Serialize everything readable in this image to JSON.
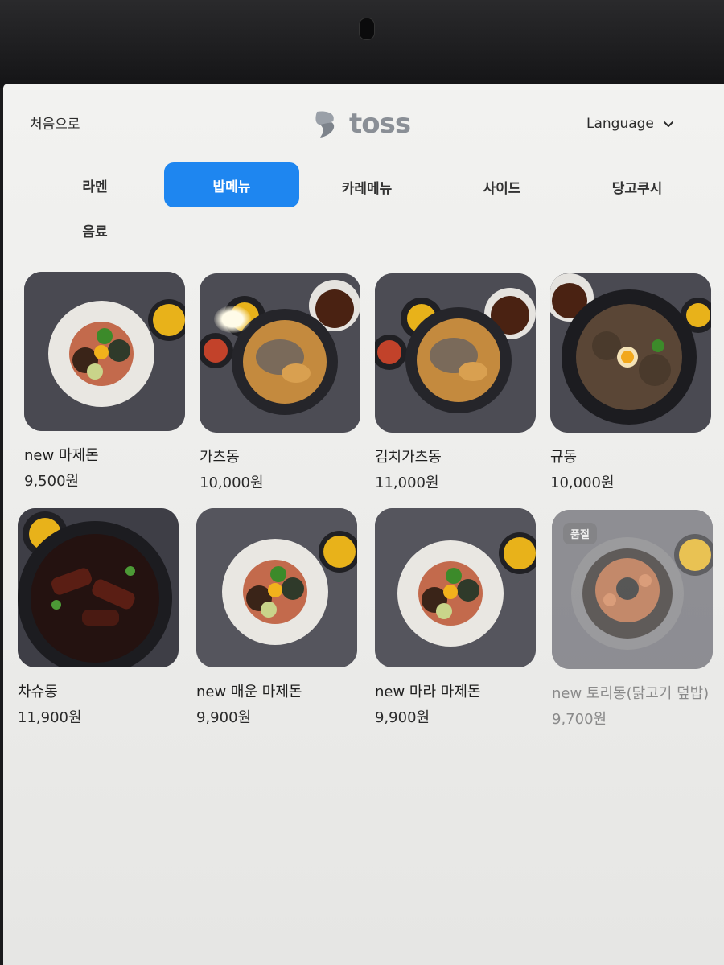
{
  "header": {
    "home_label": "처음으로",
    "logo_text": "toss",
    "language_label": "Language"
  },
  "tabs": [
    {
      "label": "라멘",
      "active": false
    },
    {
      "label": "밥메뉴",
      "active": true
    },
    {
      "label": "카레메뉴",
      "active": false
    },
    {
      "label": "사이드",
      "active": false
    },
    {
      "label": "당고쿠시",
      "active": false
    },
    {
      "label": "음료",
      "active": false
    }
  ],
  "menu_items": [
    {
      "name": "new 마제돈",
      "price": "9,500원",
      "sold_out": false
    },
    {
      "name": "가츠동",
      "price": "10,000원",
      "sold_out": false
    },
    {
      "name": "김치가츠동",
      "price": "11,000원",
      "sold_out": false
    },
    {
      "name": "규동",
      "price": "10,000원",
      "sold_out": false
    },
    {
      "name": "차슈동",
      "price": "11,900원",
      "sold_out": false
    },
    {
      "name": "new 매운 마제돈",
      "price": "9,900원",
      "sold_out": false
    },
    {
      "name": "new 마라 마제돈",
      "price": "9,900원",
      "sold_out": false
    },
    {
      "name": "new 토리동(닭고기 덮밥)",
      "price": "9,700원",
      "sold_out": true,
      "badge": "품절"
    }
  ],
  "colors": {
    "accent": "#1e86f0",
    "logo_gray": "#8a8f96"
  },
  "icons": {
    "language_dropdown": "chevron-down-icon"
  }
}
